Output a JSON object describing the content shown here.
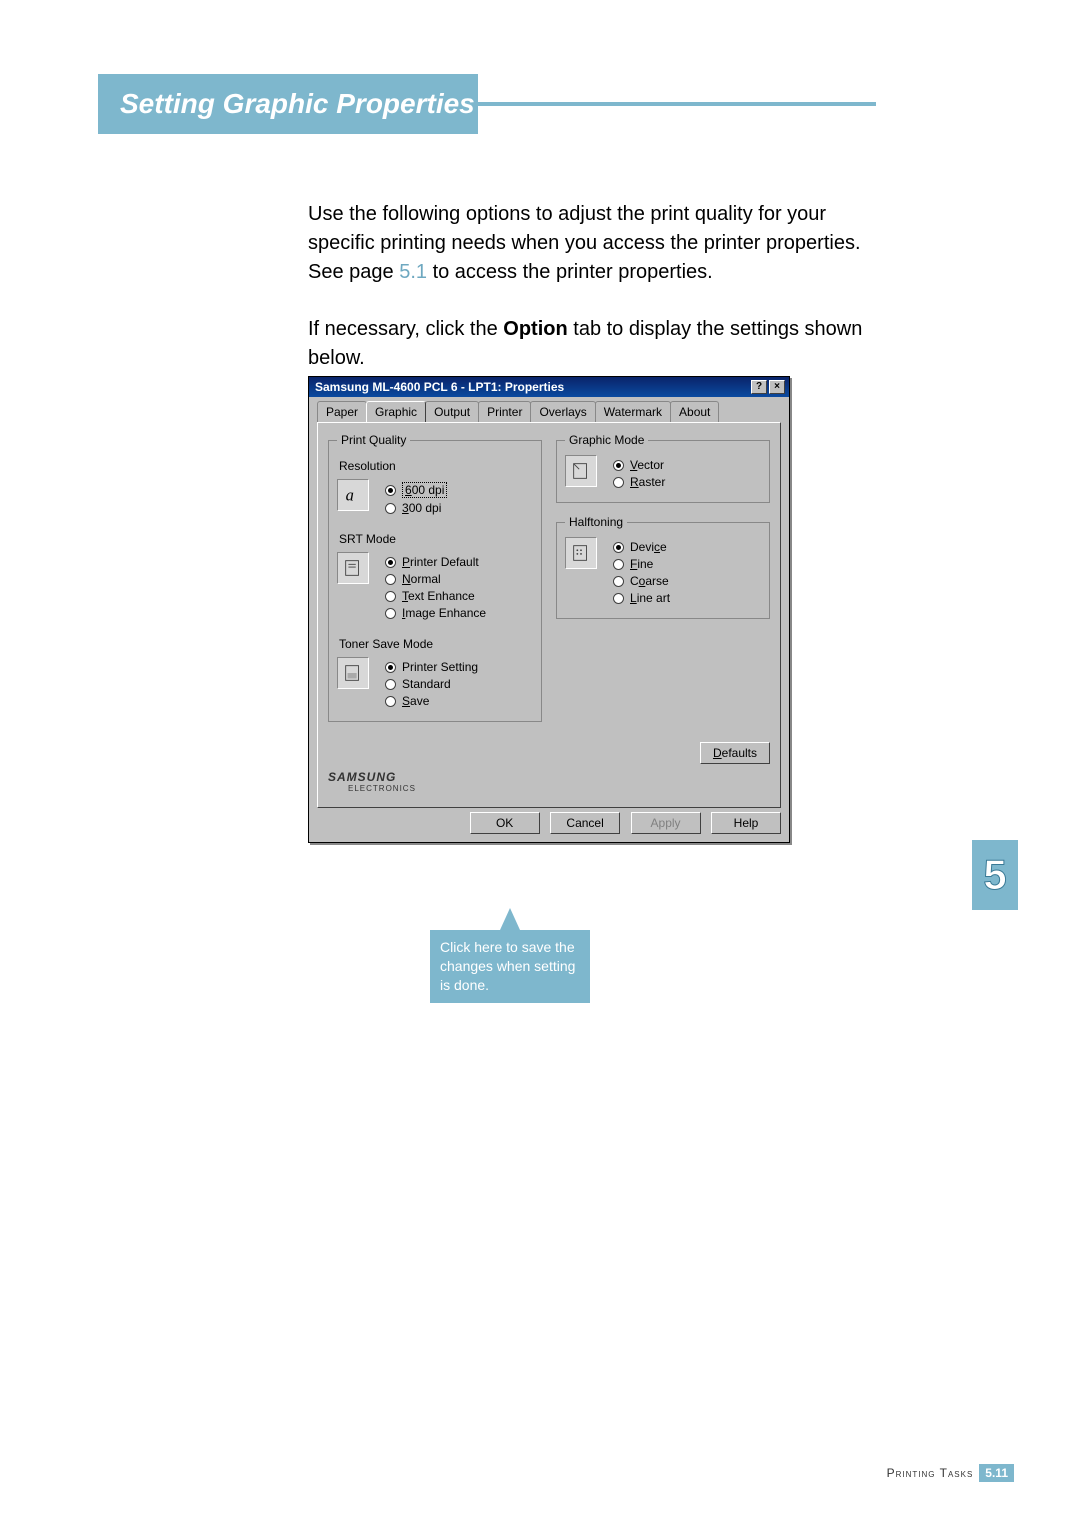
{
  "header": {
    "title": "Setting Graphic Properties"
  },
  "intro": {
    "p1a": "Use the following options to adjust the print quality for your specific printing needs when you access the printer properties. See page ",
    "p1_link": "5.1",
    "p1b": " to access the printer properties.",
    "p2a": "If necessary, click the ",
    "p2_bold": "Option",
    "p2b": " tab to display the settings shown below."
  },
  "dialog": {
    "title": "Samsung ML-4600 PCL 6 - LPT1: Properties",
    "help_btn": "?",
    "close_btn": "×",
    "tabs": [
      "Paper",
      "Graphic",
      "Output",
      "Printer",
      "Overlays",
      "Watermark",
      "About"
    ],
    "active_tab": "Graphic",
    "print_quality": {
      "legend": "Print Quality",
      "resolution_label": "Resolution",
      "resolution_opts": [
        "600 dpi",
        "300 dpi"
      ],
      "resolution_sel": "600 dpi",
      "srt_label": "SRT Mode",
      "srt_opts": [
        "Printer Default",
        "Normal",
        "Text Enhance",
        "Image Enhance"
      ],
      "srt_sel": "Printer Default",
      "toner_label": "Toner Save Mode",
      "toner_opts": [
        "Printer Setting",
        "Standard",
        "Save"
      ],
      "toner_sel": "Printer Setting"
    },
    "graphic_mode": {
      "legend": "Graphic Mode",
      "opts": [
        "Vector",
        "Raster"
      ],
      "sel": "Vector"
    },
    "halftoning": {
      "legend": "Halftoning",
      "opts": [
        "Device",
        "Fine",
        "Coarse",
        "Line art"
      ],
      "sel": "Device"
    },
    "defaults_btn": "Defaults",
    "logo": "SAMSUNG",
    "logo_sub": "ELECTRONICS",
    "buttons": {
      "ok": "OK",
      "cancel": "Cancel",
      "apply": "Apply",
      "help": "Help"
    }
  },
  "callout": "Click here to save the changes when setting is done.",
  "side_chapter": "5",
  "footer": {
    "section": "Printing Tasks",
    "page": "5.11"
  }
}
